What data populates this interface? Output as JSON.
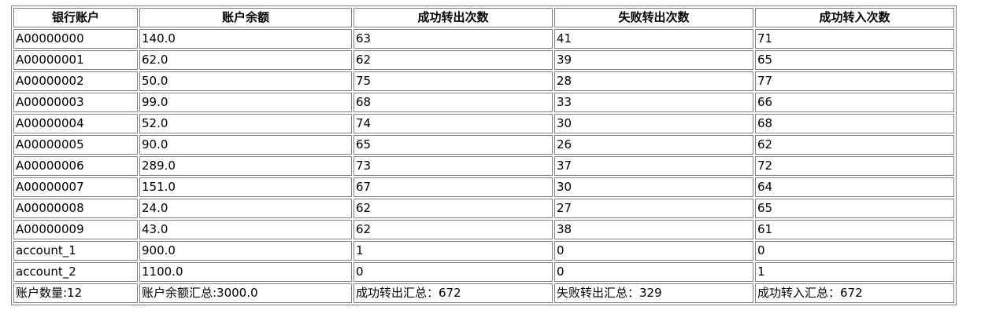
{
  "table": {
    "headers": [
      "银行账户",
      "账户余额",
      "成功转出次数",
      "失败转出次数",
      "成功转入次数"
    ],
    "rows": [
      [
        "A00000000",
        "140.0",
        "63",
        "41",
        "71"
      ],
      [
        "A00000001",
        "62.0",
        "62",
        "39",
        "65"
      ],
      [
        "A00000002",
        "50.0",
        "75",
        "28",
        "77"
      ],
      [
        "A00000003",
        "99.0",
        "68",
        "33",
        "66"
      ],
      [
        "A00000004",
        "52.0",
        "74",
        "30",
        "68"
      ],
      [
        "A00000005",
        "90.0",
        "65",
        "26",
        "62"
      ],
      [
        "A00000006",
        "289.0",
        "73",
        "37",
        "72"
      ],
      [
        "A00000007",
        "151.0",
        "67",
        "30",
        "64"
      ],
      [
        "A00000008",
        "24.0",
        "62",
        "27",
        "65"
      ],
      [
        "A00000009",
        "43.0",
        "62",
        "38",
        "61"
      ],
      [
        "account_1",
        "900.0",
        "1",
        "0",
        "0"
      ],
      [
        "account_2",
        "1100.0",
        "0",
        "0",
        "1"
      ]
    ],
    "summary": [
      "账户数量:12",
      "账户余额汇总:3000.0",
      "成功转出汇总：672",
      "失败转出汇总：329",
      "成功转入汇总：672"
    ]
  }
}
